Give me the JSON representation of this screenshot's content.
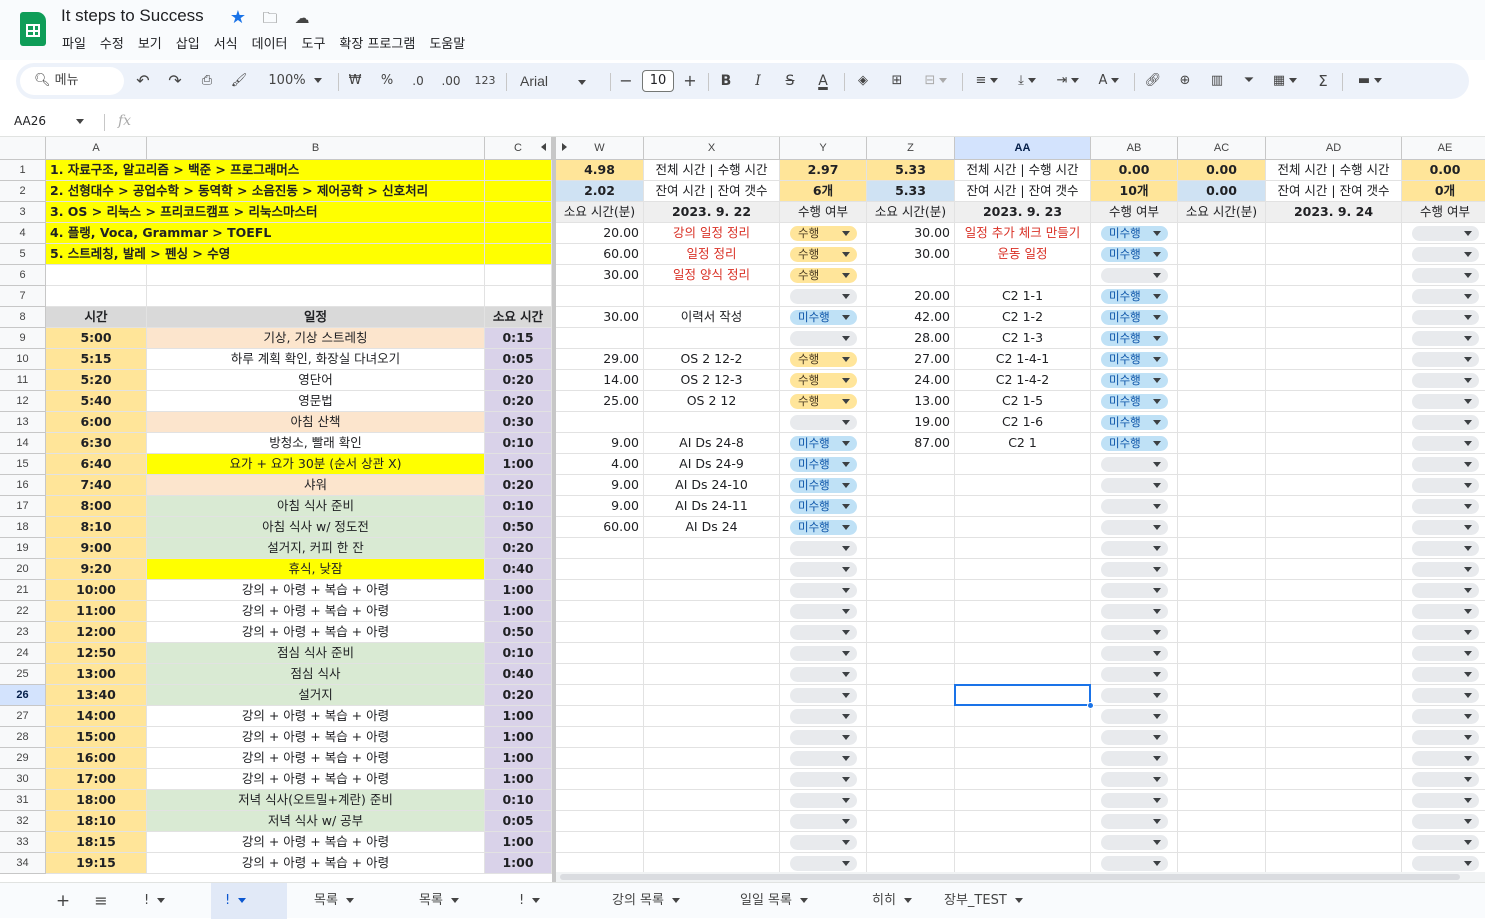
{
  "app": {
    "title": "It steps to Success",
    "menu": [
      "파일",
      "수정",
      "보기",
      "삽입",
      "서식",
      "데이터",
      "도구",
      "확장 프로그램",
      "도움말"
    ]
  },
  "toolbar": {
    "search": "메뉴",
    "zoom": "100%",
    "currency": "₩",
    "percent": "%",
    "dec_dec": ".0",
    "inc_dec": ".00",
    "number_format": "123",
    "font": "Arial",
    "font_size": "10",
    "bold": "B",
    "italic": "I",
    "underline_text": "A",
    "text_color": "A",
    "sum": "Σ"
  },
  "formula_bar": {
    "name_box": "AA26",
    "fx": "fx",
    "value": ""
  },
  "columns": [
    "A",
    "B",
    "C",
    "W",
    "X",
    "Y",
    "Z",
    "AA",
    "AB",
    "AC",
    "AD",
    "AE"
  ],
  "selected_column": "AA",
  "selected_row": "26",
  "rows": [
    "1",
    "2",
    "3",
    "4",
    "5",
    "6",
    "7",
    "8",
    "9",
    "10",
    "11",
    "12",
    "13",
    "14",
    "15",
    "16",
    "17",
    "18",
    "19",
    "20",
    "21",
    "22",
    "23",
    "24",
    "25",
    "26",
    "27",
    "28",
    "29",
    "30",
    "31",
    "32",
    "33",
    "34"
  ],
  "goals": [
    "1. 자료구조, 알고리즘 > 백준 > 프로그래머스",
    "2. 선형대수 > 공업수학 > 동역학 > 소음진동 > 제어공학 > 신호처리",
    "3. OS > 리눅스 > 프리코드캠프 > 리눅스마스터",
    "4. 플랭, Voca, Grammar > TOEFL",
    "5. 스트레칭, 발레 > 펜싱 > 수영"
  ],
  "schedule_header": {
    "time": "시간",
    "task": "일정",
    "duration": "소요 시간"
  },
  "schedule": [
    {
      "time": "5:00",
      "task": "기상, 기상 스트레칭",
      "duration": "0:15",
      "color": "#fce5cd"
    },
    {
      "time": "5:15",
      "task": "하루 계획 확인, 화장실 다녀오기",
      "duration": "0:05",
      "color": "#ffffff"
    },
    {
      "time": "5:20",
      "task": "영단어",
      "duration": "0:20",
      "color": "#ffffff"
    },
    {
      "time": "5:40",
      "task": "영문법",
      "duration": "0:20",
      "color": "#ffffff"
    },
    {
      "time": "6:00",
      "task": "아침 산책",
      "duration": "0:30",
      "color": "#fce5cd"
    },
    {
      "time": "6:30",
      "task": "방청소, 빨래 확인",
      "duration": "0:10",
      "color": "#ffffff"
    },
    {
      "time": "6:40",
      "task": "요가 +       요가 30분 (순서 상관 X)",
      "duration": "1:00",
      "color": "#ffff00"
    },
    {
      "time": "7:40",
      "task": "샤워",
      "duration": "0:20",
      "color": "#fce5cd"
    },
    {
      "time": "8:00",
      "task": "아침 식사 준비",
      "duration": "0:10",
      "color": "#d9ead3"
    },
    {
      "time": "8:10",
      "task": "아침 식사 w/ 정도전",
      "duration": "0:50",
      "color": "#d9ead3"
    },
    {
      "time": "9:00",
      "task": "설거지, 커피 한 잔",
      "duration": "0:20",
      "color": "#d9ead3"
    },
    {
      "time": "9:20",
      "task": "휴식, 낮잠",
      "duration": "0:40",
      "color": "#ffff00"
    },
    {
      "time": "10:00",
      "task": "강의 + 아령 + 복습 + 아령",
      "duration": "1:00",
      "color": "#ffffff"
    },
    {
      "time": "11:00",
      "task": "강의 + 아령 + 복습 + 아령",
      "duration": "1:00",
      "color": "#ffffff"
    },
    {
      "time": "12:00",
      "task": "강의 + 아령 + 복습 + 아령",
      "duration": "0:50",
      "color": "#ffffff"
    },
    {
      "time": "12:50",
      "task": "점심 식사 준비",
      "duration": "0:10",
      "color": "#d9ead3"
    },
    {
      "time": "13:00",
      "task": "점심 식사",
      "duration": "0:40",
      "color": "#d9ead3"
    },
    {
      "time": "13:40",
      "task": "설거지",
      "duration": "0:20",
      "color": "#d9ead3"
    },
    {
      "time": "14:00",
      "task": "강의 + 아령 + 복습 + 아령",
      "duration": "1:00",
      "color": "#ffffff"
    },
    {
      "time": "15:00",
      "task": "강의 + 아령 + 복습 + 아령",
      "duration": "1:00",
      "color": "#ffffff"
    },
    {
      "time": "16:00",
      "task": "강의 + 아령 + 복습 + 아령",
      "duration": "1:00",
      "color": "#ffffff"
    },
    {
      "time": "17:00",
      "task": "강의 + 아령 + 복습 + 아령",
      "duration": "1:00",
      "color": "#ffffff"
    },
    {
      "time": "18:00",
      "task": "저녁 식사(오트밀+계란) 준비",
      "duration": "0:10",
      "color": "#d9ead3"
    },
    {
      "time": "18:10",
      "task": "저녁 식사 w/ 공부",
      "duration": "0:05",
      "color": "#d9ead3"
    },
    {
      "time": "18:15",
      "task": "강의 + 아령 + 복습 + 아령",
      "duration": "1:00",
      "color": "#ffffff"
    },
    {
      "time": "19:15",
      "task": "강의 + 아령 + 복습 + 아령",
      "duration": "1:00",
      "color": "#ffffff"
    }
  ],
  "days": [
    {
      "date": "2023. 9. 22",
      "total_label": "전체 시간 | 수행 시간",
      "total": "4.98",
      "done": "2.97",
      "remain_label": "잔여 시간 | 잔여 갯수",
      "remain": "2.02",
      "remain_count": "6개",
      "sub": {
        "minutes": "소요 시간(분)",
        "status": "수행 여부"
      },
      "tasks": [
        {
          "m": "20.00",
          "t": "강의 일정 정리",
          "s": "수행",
          "red": true
        },
        {
          "m": "60.00",
          "t": "일정 정리",
          "s": "수행",
          "red": true
        },
        {
          "m": "30.00",
          "t": "일정 양식 정리",
          "s": "수행",
          "red": true
        },
        {
          "m": "",
          "t": "",
          "s": ""
        },
        {
          "m": "30.00",
          "t": "이력서 작성",
          "s": "미수행"
        },
        {
          "m": "",
          "t": "",
          "s": ""
        },
        {
          "m": "29.00",
          "t": "OS 2 12-2",
          "s": "수행"
        },
        {
          "m": "14.00",
          "t": "OS 2 12-3",
          "s": "수행"
        },
        {
          "m": "25.00",
          "t": "OS 2 12",
          "s": "수행"
        },
        {
          "m": "",
          "t": "",
          "s": ""
        },
        {
          "m": "9.00",
          "t": "AI Ds 24-8",
          "s": "미수행"
        },
        {
          "m": "4.00",
          "t": "AI Ds 24-9",
          "s": "미수행"
        },
        {
          "m": "9.00",
          "t": "AI Ds 24-10",
          "s": "미수행"
        },
        {
          "m": "9.00",
          "t": "AI Ds 24-11",
          "s": "미수행"
        },
        {
          "m": "60.00",
          "t": "AI Ds 24",
          "s": "미수행"
        }
      ]
    },
    {
      "date": "2023. 9. 23",
      "total_label": "전체 시간 | 수행 시간",
      "total": "5.33",
      "done": "0.00",
      "remain_label": "잔여 시간 | 잔여 갯수",
      "remain": "5.33",
      "remain_count": "10개",
      "sub": {
        "minutes": "소요 시간(분)",
        "status": "수행 여부"
      },
      "tasks": [
        {
          "m": "30.00",
          "t": "일정 추가 체크 만들기",
          "s": "미수행",
          "red": true
        },
        {
          "m": "30.00",
          "t": "운동 일정",
          "s": "미수행",
          "red": true
        },
        {
          "m": "",
          "t": "",
          "s": ""
        },
        {
          "m": "20.00",
          "t": "C2 1-1",
          "s": "미수행"
        },
        {
          "m": "42.00",
          "t": "C2 1-2",
          "s": "미수행"
        },
        {
          "m": "28.00",
          "t": "C2 1-3",
          "s": "미수행"
        },
        {
          "m": "27.00",
          "t": "C2 1-4-1",
          "s": "미수행"
        },
        {
          "m": "24.00",
          "t": "C2 1-4-2",
          "s": "미수행"
        },
        {
          "m": "13.00",
          "t": "C2 1-5",
          "s": "미수행"
        },
        {
          "m": "19.00",
          "t": "C2 1-6",
          "s": "미수행"
        },
        {
          "m": "87.00",
          "t": "C2 1",
          "s": "미수행"
        }
      ]
    },
    {
      "date": "2023. 9. 24",
      "total_label": "전체 시간 | 수행 시간",
      "total": "0.00",
      "done": "0.00",
      "remain_label": "잔여 시간 | 잔여 갯수",
      "remain": "0.00",
      "remain_count": "0개",
      "sub": {
        "minutes": "소요 시간(분)",
        "status": "수행 여부"
      },
      "tasks": []
    }
  ],
  "sheet_tabs": [
    "!",
    "!",
    "목록",
    "목록",
    "!",
    "강의 목록",
    "일일 목록",
    "히히",
    "장부_TEST"
  ],
  "colors": {
    "yellow": "#ffff00",
    "peach": "#fce5cd",
    "green": "#d9ead3",
    "lavender": "#d9d2e9",
    "gold": "#ffe599",
    "blue": "#cfe2f3",
    "header_gray": "#d9d9d9",
    "accent": "#1a73e8"
  }
}
